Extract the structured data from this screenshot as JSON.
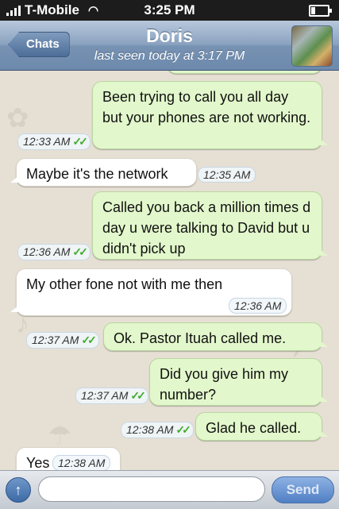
{
  "status_bar": {
    "carrier": "T-Mobile",
    "time": "3:25 PM",
    "signal_bars": 4,
    "battery_level": 0.25
  },
  "header": {
    "back_label": "Chats",
    "contact_name": "Doris",
    "last_seen": "last seen today at 3:17 PM"
  },
  "messages": [
    {
      "direction": "out",
      "text": "Been trying to call you all day but your phones are not working.",
      "time": "12:33 AM",
      "read": true
    },
    {
      "direction": "in",
      "text": "Maybe it's the network",
      "time": "12:35 AM"
    },
    {
      "direction": "out",
      "text": "Called you back a million times d day u were talking to David but u didn't pick up",
      "time": "12:36 AM",
      "read": true
    },
    {
      "direction": "in",
      "text": "My other fone not with me then",
      "time": "12:36 AM"
    },
    {
      "direction": "out",
      "text": "Ok. Pastor Ituah called me.",
      "time": "12:37 AM",
      "read": true
    },
    {
      "direction": "out",
      "text": "Did you give him my number?",
      "time": "12:37 AM",
      "read": true
    },
    {
      "direction": "out",
      "text": "Glad he called.",
      "time": "12:38 AM",
      "read": true
    },
    {
      "direction": "in",
      "text": "Yes",
      "time": "12:38 AM"
    }
  ],
  "composer": {
    "placeholder": "",
    "send_label": "Send"
  },
  "colors": {
    "outgoing_bubble": "#e2f7cb",
    "incoming_bubble": "#ffffff",
    "read_check": "#3fae2a",
    "nav_bar": "#7792b3"
  }
}
